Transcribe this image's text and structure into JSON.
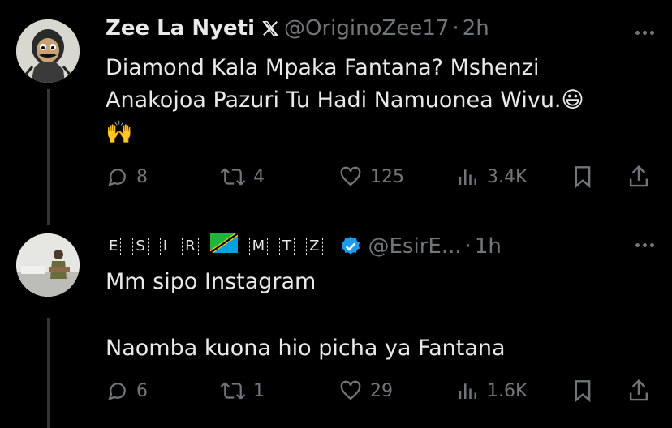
{
  "tweets": [
    {
      "display_name": "Zee La Nyeti",
      "handle": "@OriginoZee17",
      "time": "2h",
      "body_lines": [
        "Diamond Kala Mpaka Fantana? Mshenzi",
        "Anakojoa Pazuri Tu Hadi Namuonea Wivu."
      ],
      "emoji_smile": "😃",
      "emoji_hands": "🙌",
      "replies": "8",
      "reposts": "4",
      "likes": "125",
      "views": "3.4K"
    },
    {
      "display_name_chars": [
        "E",
        "S",
        "I",
        "R",
        "M",
        "T",
        "Z"
      ],
      "handle": "@EsirE...",
      "time": "1h",
      "body_lines": [
        "Mm sipo Instagram",
        "Naomba kuona hio picha ya Fantana"
      ],
      "replies": "6",
      "reposts": "1",
      "likes": "29",
      "views": "1.6K"
    }
  ],
  "separator_dot": "·",
  "icons": [
    "x-logo-icon",
    "more-icon",
    "reply-icon",
    "repost-icon",
    "like-icon",
    "views-icon",
    "bookmark-icon",
    "share-icon",
    "verified-badge-icon",
    "tanzania-flag-icon"
  ],
  "colors": {
    "background": "#000000",
    "text": "#e7e9ea",
    "muted": "#71767b",
    "verified": "#1d9bf0"
  }
}
